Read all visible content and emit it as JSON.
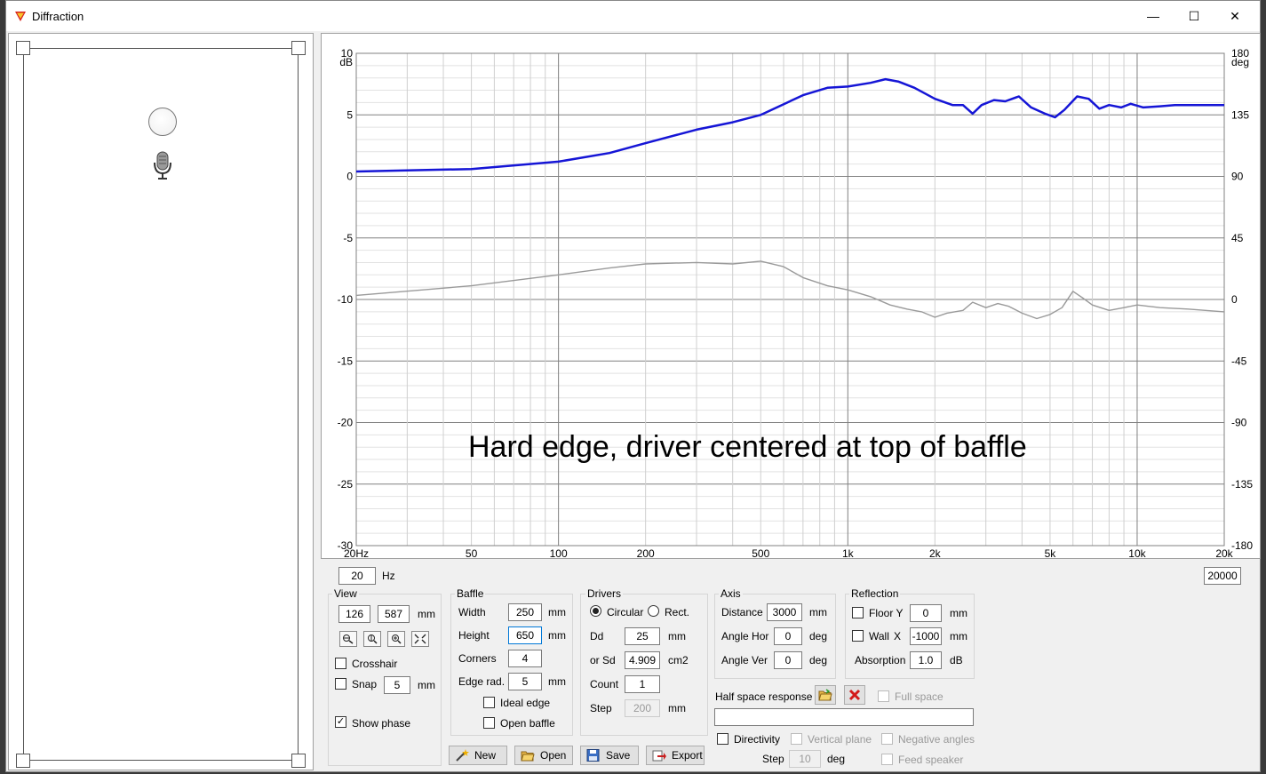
{
  "window": {
    "title": "Diffraction",
    "minimize": "—",
    "maximize": "☐",
    "close": "✕"
  },
  "graph": {
    "overlay": "Hard edge, driver centered at top of baffle",
    "left_ticks": [
      "10",
      "5",
      "0",
      "-5",
      "-10",
      "-15",
      "-20",
      "-25",
      "-30"
    ],
    "left_unit": "dB",
    "right_ticks": [
      "180",
      "135",
      "90",
      "45",
      "0",
      "-45",
      "-90",
      "-135",
      "-180"
    ],
    "right_unit": "deg",
    "x_ticks": [
      "20Hz",
      "50",
      "100",
      "200",
      "500",
      "1k",
      "2k",
      "5k",
      "10k",
      "20k"
    ]
  },
  "chart_data": {
    "type": "line",
    "xscale": "log",
    "xlim": [
      20,
      20000
    ],
    "ylim": [
      -30,
      10
    ],
    "ylabel": "dB",
    "y2lim": [
      -180,
      180
    ],
    "y2label": "deg",
    "grid": true,
    "series": [
      {
        "color": "#1515d6",
        "axis": "left",
        "x": [
          20,
          50,
          100,
          150,
          200,
          300,
          400,
          500,
          700,
          850,
          1000,
          1200,
          1350,
          1500,
          1700,
          2000,
          2300,
          2500,
          2700,
          2900,
          3200,
          3500,
          3900,
          4300,
          4800,
          5200,
          5600,
          6200,
          6800,
          7400,
          8000,
          8800,
          9500,
          10500,
          12000,
          13500,
          15000,
          17000,
          20000
        ],
        "y": [
          0.4,
          0.6,
          1.2,
          1.9,
          2.7,
          3.8,
          4.4,
          5.0,
          6.6,
          7.2,
          7.3,
          7.6,
          7.9,
          7.7,
          7.2,
          6.3,
          5.8,
          5.8,
          5.1,
          5.8,
          6.2,
          6.1,
          6.5,
          5.6,
          5.1,
          4.8,
          5.4,
          6.5,
          6.3,
          5.5,
          5.8,
          5.6,
          5.9,
          5.6,
          5.7,
          5.8,
          5.8,
          5.8,
          5.8
        ]
      },
      {
        "color": "#9a9a9a",
        "axis": "right",
        "x": [
          20,
          50,
          100,
          150,
          200,
          300,
          400,
          500,
          600,
          700,
          850,
          1000,
          1200,
          1400,
          1600,
          1800,
          2000,
          2200,
          2500,
          2700,
          3000,
          3300,
          3600,
          4000,
          4500,
          5000,
          5500,
          6000,
          6500,
          7000,
          8000,
          9000,
          10000,
          12000,
          15000,
          20000
        ],
        "y": [
          3,
          10,
          18,
          23,
          26,
          27,
          26,
          28,
          24,
          16,
          10,
          7,
          2,
          -4,
          -7,
          -9,
          -13,
          -10,
          -8,
          -2,
          -6,
          -3,
          -5,
          -10,
          -14,
          -11,
          -6,
          6,
          1,
          -4,
          -8,
          -6,
          -4,
          -6,
          -7,
          -9
        ]
      }
    ]
  },
  "freq": {
    "min": "20",
    "unit": "Hz",
    "max": "20000"
  },
  "view": {
    "title": "View",
    "x": "126",
    "y": "587",
    "unit": "mm",
    "crosshair": "Crosshair",
    "snap": "Snap",
    "snap_value": "5",
    "snap_unit": "mm",
    "show_phase": "Show phase"
  },
  "baffle": {
    "title": "Baffle",
    "width_label": "Width",
    "width": "250",
    "height_label": "Height",
    "height": "650",
    "corners_label": "Corners",
    "corners": "4",
    "edge_label": "Edge rad.",
    "edge": "5",
    "unit": "mm",
    "ideal_edge": "Ideal edge",
    "open_baffle": "Open baffle"
  },
  "drivers": {
    "title": "Drivers",
    "circular": "Circular",
    "rect": "Rect.",
    "dd_label": "Dd",
    "dd": "25",
    "dd_unit": "mm",
    "sd_label": "or Sd",
    "sd": "4.909",
    "sd_unit": "cm2",
    "count_label": "Count",
    "count": "1",
    "step_label": "Step",
    "step": "200",
    "step_unit": "mm"
  },
  "axis": {
    "title": "Axis",
    "distance_label": "Distance",
    "distance": "3000",
    "distance_unit": "mm",
    "hor_label": "Angle Hor",
    "hor": "0",
    "ver_label": "Angle Ver",
    "ver": "0",
    "deg": "deg"
  },
  "reflection": {
    "title": "Reflection",
    "floor_label": "Floor Y",
    "floor": "0",
    "wall_label": "Wall",
    "wall_axis": "X",
    "wall": "-1000",
    "unit": "mm",
    "absorption_label": "Absorption",
    "absorption": "1.0",
    "absorption_unit": "dB"
  },
  "halfspace": {
    "label": "Half space response",
    "full_space": "Full space",
    "path": ""
  },
  "directivity": {
    "label": "Directivity",
    "vertical_plane": "Vertical plane",
    "negative_angles": "Negative angles",
    "step_label": "Step",
    "step": "10",
    "deg": "deg",
    "feed_speaker": "Feed speaker"
  },
  "buttons": {
    "new": "New",
    "open": "Open",
    "save": "Save",
    "export": "Export"
  },
  "checks": {
    "show_phase": "✓"
  },
  "icons": [
    "app-icon",
    "microphone-icon",
    "zoom-x-icon",
    "zoom-y-icon",
    "zoom-in-icon",
    "zoom-fit-icon",
    "folder-icon",
    "delete-icon",
    "wand-icon",
    "save-icon",
    "export-icon"
  ]
}
